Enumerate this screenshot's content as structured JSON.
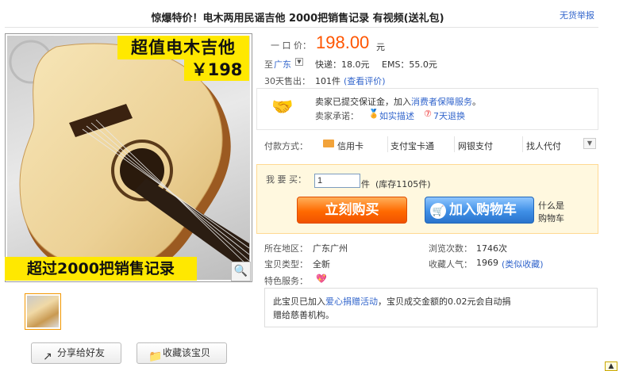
{
  "title": "惊爆特价！电木两用民谣吉他  2000把销售记录  有视频(送礼包)",
  "report_link": "无货举报",
  "image": {
    "banner_top": "超值电木吉他",
    "banner_price": "￥198",
    "banner_bottom": "超过2000把销售记录",
    "zoom_icon": "magnifier-icon"
  },
  "share_button": "分享给好友",
  "favorite_button": "收藏该宝贝",
  "price_label": "一 口 价：",
  "price_value": "198.00",
  "price_unit": "元",
  "shipping": {
    "to_label": "至",
    "destination": "广东",
    "express": "快递：18.0元",
    "ems": "EMS：55.0元"
  },
  "sales": {
    "label": "30天售出：",
    "count": "101件",
    "view_reviews": "(查看评价)"
  },
  "guarantee": {
    "line1_prefix": "卖家已提交保证金，加入",
    "line1_link": "消费者保障服务",
    "line1_suffix": "。",
    "line2_label": "卖家承诺：",
    "promise1": "如实描述",
    "promise2": "7天退换"
  },
  "payment": {
    "label": "付款方式：",
    "methods": [
      "信用卡",
      "支付宝卡通",
      "网银支付",
      "找人代付"
    ]
  },
  "buy": {
    "qty_label": "我 要 买：",
    "qty_value": "1",
    "unit": "件",
    "stock": "(库存1105件)",
    "buy_now": "立刻购买",
    "add_cart": "加入购物车",
    "what_is_cart_1": "什么是",
    "what_is_cart_2": "购物车"
  },
  "details": {
    "region_label": "所在地区：",
    "region_value": "广东广州",
    "views_label": "浏览次数：",
    "views_value": "1746次",
    "type_label": "宝贝类型：",
    "type_value": "全新",
    "popularity_label": "收藏人气：",
    "popularity_value": "1969",
    "popularity_link": "(类似收藏)",
    "special_label": "特色服务："
  },
  "charity": {
    "prefix": "此宝贝已加入",
    "link": "爱心捐赠活动",
    "text1": "，宝贝成交金额的0.02元会自动捐",
    "text2": "赠给慈善机构。"
  },
  "colors": {
    "price": "#ff5500",
    "link": "#3366cc",
    "buy_now": "#ff6a00",
    "add_cart": "#3f8fe6",
    "banner": "#ffe800"
  }
}
